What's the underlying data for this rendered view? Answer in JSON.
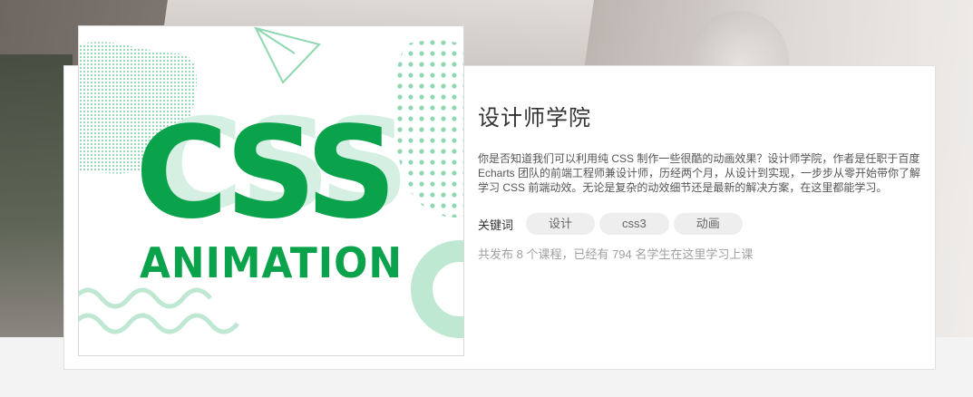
{
  "course": {
    "cover": {
      "headline": "CSS",
      "subline": "ANIMATION",
      "accent_color": "#0aa24b",
      "light_color": "#bfe8d3"
    },
    "title": "设计师学院",
    "description": "你是否知道我们可以利用纯 CSS 制作一些很酷的动画效果？设计师学院，作者是任职于百度 Echarts 团队的前端工程师兼设计师，历经两个月，从设计到实现，一步步从零开始带你了解学习 CSS 前端动效。无论是复杂的动效细节还是最新的解决方案，在这里都能学习。",
    "keywords_label": "关键词",
    "keywords": [
      "设计",
      "css3",
      "动画"
    ],
    "stats": "共发布 8 个课程，已经有 794 名学生在这里学习上课"
  }
}
